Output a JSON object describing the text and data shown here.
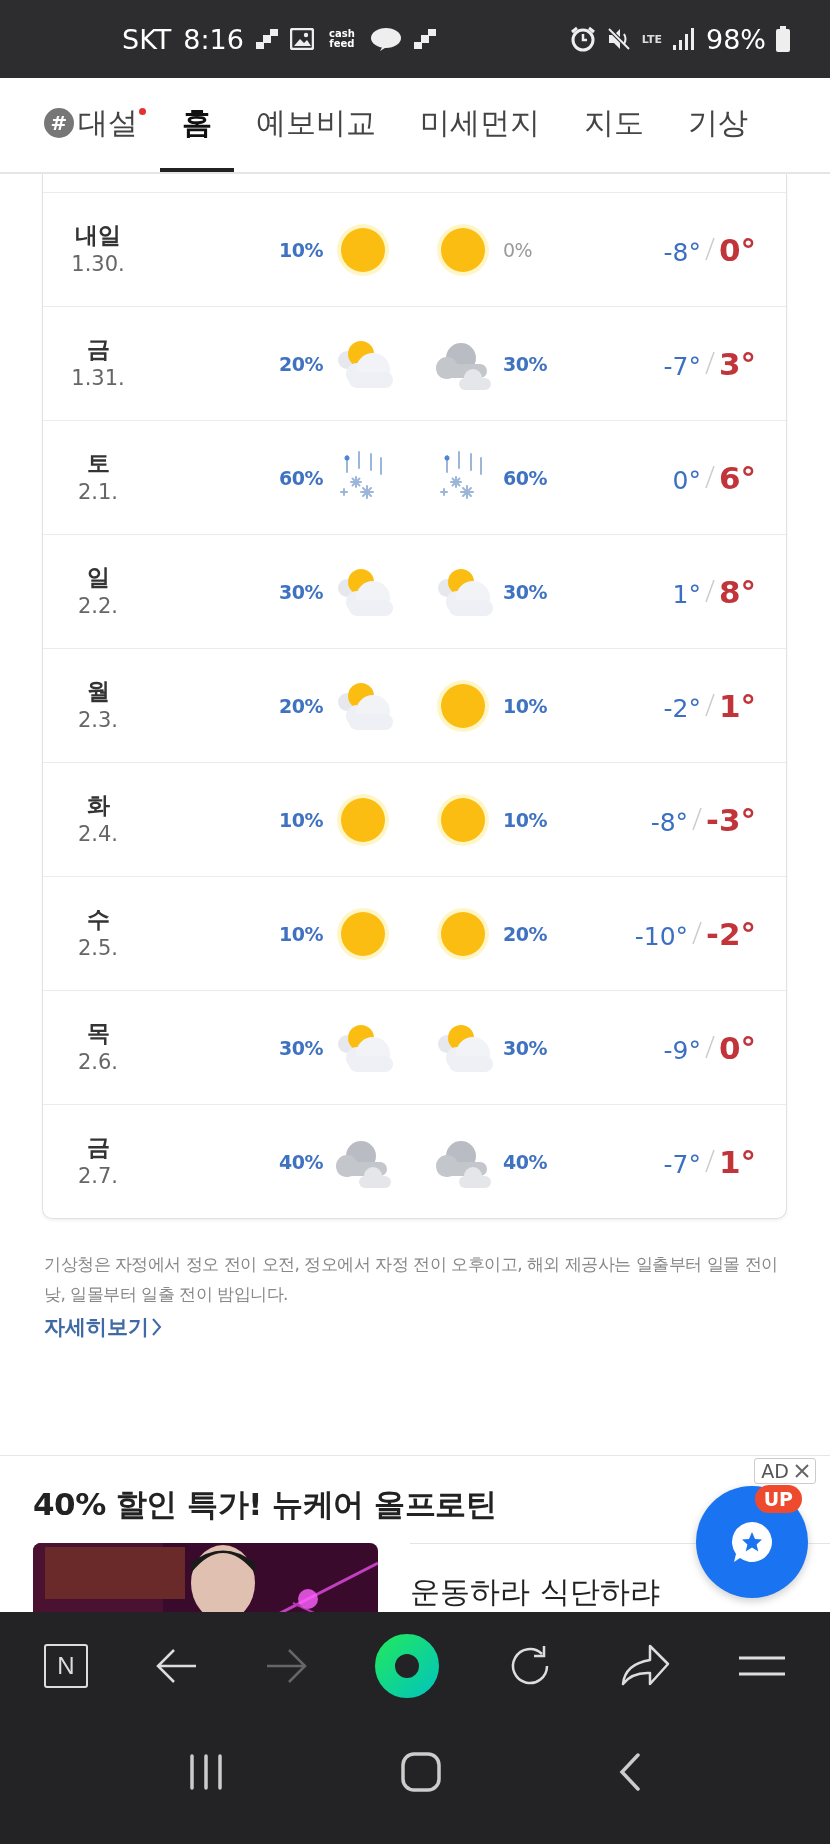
{
  "status_bar": {
    "carrier": "SKT",
    "time": "8:16",
    "app_badge": "cash feed",
    "network": "LTE",
    "battery": "98%"
  },
  "tabs": [
    {
      "label": "대설",
      "hash": "#",
      "new": true,
      "selected": false
    },
    {
      "label": "홈",
      "selected": true
    },
    {
      "label": "예보비교",
      "selected": false
    },
    {
      "label": "미세먼지",
      "selected": false
    },
    {
      "label": "지도",
      "selected": false
    },
    {
      "label": "기상",
      "selected": false
    }
  ],
  "forecast": [
    {
      "day": "내일",
      "date": "1.30.",
      "am": {
        "kind": "sun",
        "pop": "10%",
        "faded": false
      },
      "pm": {
        "kind": "sun",
        "pop": "0%",
        "faded": true
      },
      "low": "-8°",
      "high": "0°"
    },
    {
      "day": "금",
      "date": "1.31.",
      "am": {
        "kind": "partly",
        "pop": "20%",
        "faded": false
      },
      "pm": {
        "kind": "cloudy",
        "pop": "30%",
        "faded": false
      },
      "low": "-7°",
      "high": "3°"
    },
    {
      "day": "토",
      "date": "2.1.",
      "am": {
        "kind": "sleet",
        "pop": "60%",
        "faded": false
      },
      "pm": {
        "kind": "sleet",
        "pop": "60%",
        "faded": false
      },
      "low": "0°",
      "high": "6°"
    },
    {
      "day": "일",
      "date": "2.2.",
      "am": {
        "kind": "partly",
        "pop": "30%",
        "faded": false
      },
      "pm": {
        "kind": "partly",
        "pop": "30%",
        "faded": false
      },
      "low": "1°",
      "high": "8°"
    },
    {
      "day": "월",
      "date": "2.3.",
      "am": {
        "kind": "partly",
        "pop": "20%",
        "faded": false
      },
      "pm": {
        "kind": "sun",
        "pop": "10%",
        "faded": false
      },
      "low": "-2°",
      "high": "1°"
    },
    {
      "day": "화",
      "date": "2.4.",
      "am": {
        "kind": "sun",
        "pop": "10%",
        "faded": false
      },
      "pm": {
        "kind": "sun",
        "pop": "10%",
        "faded": false
      },
      "low": "-8°",
      "high": "-3°"
    },
    {
      "day": "수",
      "date": "2.5.",
      "am": {
        "kind": "sun",
        "pop": "10%",
        "faded": false
      },
      "pm": {
        "kind": "sun",
        "pop": "20%",
        "faded": false
      },
      "low": "-10°",
      "high": "-2°"
    },
    {
      "day": "목",
      "date": "2.6.",
      "am": {
        "kind": "partly",
        "pop": "30%",
        "faded": false
      },
      "pm": {
        "kind": "partly",
        "pop": "30%",
        "faded": false
      },
      "low": "-9°",
      "high": "0°"
    },
    {
      "day": "금",
      "date": "2.7.",
      "am": {
        "kind": "cloudy",
        "pop": "40%",
        "faded": false
      },
      "pm": {
        "kind": "cloudy",
        "pop": "40%",
        "faded": false
      },
      "low": "-7°",
      "high": "1°"
    }
  ],
  "footnote": "기상청은 자정에서 정오 전이 오전, 정오에서 자정 전이 오후이고, 해외 제공사는 일출부터 일몰 전이 낮, 일몰부터 일출 전이 밤입니다.",
  "more_link": "자세히보기",
  "ad": {
    "title": "40% 할인 특가! 뉴케어 올프로틴",
    "label": "AD",
    "headline": "운동하라 식단하랴"
  },
  "chat_button": {
    "badge": "UP"
  },
  "browser_bar": {
    "home_letter": "N",
    "forward_disabled": true
  }
}
